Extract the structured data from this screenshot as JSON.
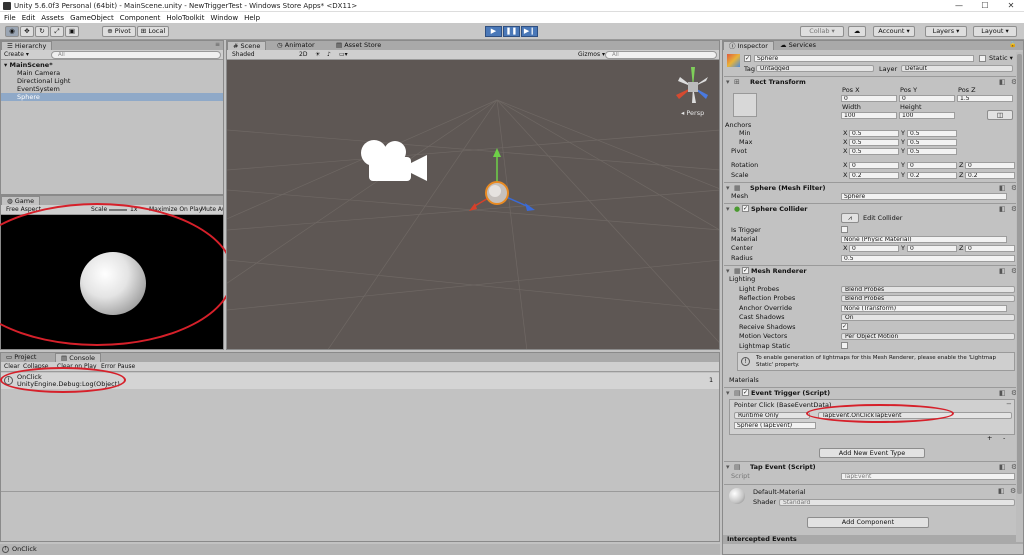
{
  "window": {
    "title": "Unity 5.6.0f3 Personal (64bit) - MainScene.unity - NewTriggerTest - Windows Store Apps* <DX11>",
    "min": "—",
    "max": "☐",
    "close": "✕"
  },
  "menu": [
    "File",
    "Edit",
    "Assets",
    "GameObject",
    "Component",
    "HoloToolkit",
    "Window",
    "Help"
  ],
  "toolbar": {
    "pivot": "Pivot",
    "local": "Local",
    "collab": "Collab ▾",
    "account": "Account ▾",
    "layers": "Layers ▾",
    "layout": "Layout ▾"
  },
  "hierarchy": {
    "tab": "Hierarchy",
    "create": "Create ▾",
    "search": "All",
    "scene": "MainScene*",
    "items": [
      "Main Camera",
      "Directional Light",
      "EventSystem",
      "Sphere"
    ]
  },
  "scene": {
    "tabs": [
      "Scene",
      "Animator",
      "Asset Store"
    ],
    "shaded": "Shaded",
    "mode2d": "2D",
    "gizmos": "Gizmos ▾",
    "search": "All",
    "persp": "Persp"
  },
  "game": {
    "tab": "Game",
    "aspect": "Free Aspect",
    "scale_label": "Scale",
    "scale_value": "1x",
    "maximize": "Maximize On Play",
    "mute": "Mute Au"
  },
  "console": {
    "tabs": [
      "Project",
      "Console"
    ],
    "toolbar": [
      "Clear",
      "Collapse",
      "Clear on Play",
      "Error Pause"
    ],
    "log_line1": "OnClick",
    "log_line2": "UnityEngine.Debug:Log(Object)",
    "count": "1"
  },
  "status": {
    "text": "OnClick"
  },
  "inspector": {
    "tabs": [
      "Inspector",
      "Services"
    ],
    "object_name": "Sphere",
    "static_label": "Static ▾",
    "tag_label": "Tag",
    "tag_value": "Untagged",
    "layer_label": "Layer",
    "layer_value": "Default",
    "rect_transform": {
      "title": "Rect Transform",
      "pos_headers": [
        "Pos X",
        "Pos Y",
        "Pos Z"
      ],
      "pos_values": [
        "0",
        "0",
        "1.5"
      ],
      "size_headers": [
        "Width",
        "Height"
      ],
      "size_values": [
        "100",
        "100"
      ],
      "anchors": "Anchors",
      "min": "Min",
      "max": "Max",
      "pivot": "Pivot",
      "x": "X",
      "y": "Y",
      "z": "Z",
      "min_values": [
        "0.5",
        "0.5"
      ],
      "max_values": [
        "0.5",
        "0.5"
      ],
      "pivot_values": [
        "0.5",
        "0.5"
      ],
      "rotation": "Rotation",
      "rotation_values": [
        "0",
        "0",
        "0"
      ],
      "scale": "Scale",
      "scale_values": [
        "0.2",
        "0.2",
        "0.2"
      ]
    },
    "mesh_filter": {
      "title": "Sphere (Mesh Filter)",
      "mesh_label": "Mesh",
      "mesh_value": "Sphere"
    },
    "sphere_collider": {
      "title": "Sphere Collider",
      "edit": "Edit Collider",
      "is_trigger": "Is Trigger",
      "material": "Material",
      "material_value": "None (Physic Material)",
      "center": "Center",
      "center_values": [
        "0",
        "0",
        "0"
      ],
      "radius": "Radius",
      "radius_value": "0.5"
    },
    "mesh_renderer": {
      "title": "Mesh Renderer",
      "lighting": "Lighting",
      "light_probes": "Light Probes",
      "light_probes_value": "Blend Probes",
      "reflection_probes": "Reflection Probes",
      "reflection_probes_value": "Blend Probes",
      "anchor_override": "Anchor Override",
      "anchor_override_value": "None (Transform)",
      "cast_shadows": "Cast Shadows",
      "cast_shadows_value": "On",
      "receive_shadows": "Receive Shadows",
      "motion_vectors": "Motion Vectors",
      "motion_vectors_value": "Per Object Motion",
      "lightmap_static": "Lightmap Static",
      "info": "To enable generation of lightmaps for this Mesh Renderer, please enable the 'Lightmap Static' property.",
      "materials": "Materials"
    },
    "event_trigger": {
      "title": "Event Trigger (Script)",
      "entry": "Pointer Click (BaseEventData)",
      "runtime": "Runtime Only",
      "function": "TapEvent.OnClickTapEvent",
      "object": "Sphere (TapEvent)",
      "plus": "+",
      "minus": "-",
      "add_new": "Add New Event Type"
    },
    "tap_event": {
      "title": "Tap Event (Script)",
      "script_label": "Script",
      "script_value": "TapEvent"
    },
    "material": {
      "name": "Default-Material",
      "shader_label": "Shader",
      "shader_value": "Standard"
    },
    "add_component": "Add Component",
    "intercepted": "Intercepted Events"
  }
}
